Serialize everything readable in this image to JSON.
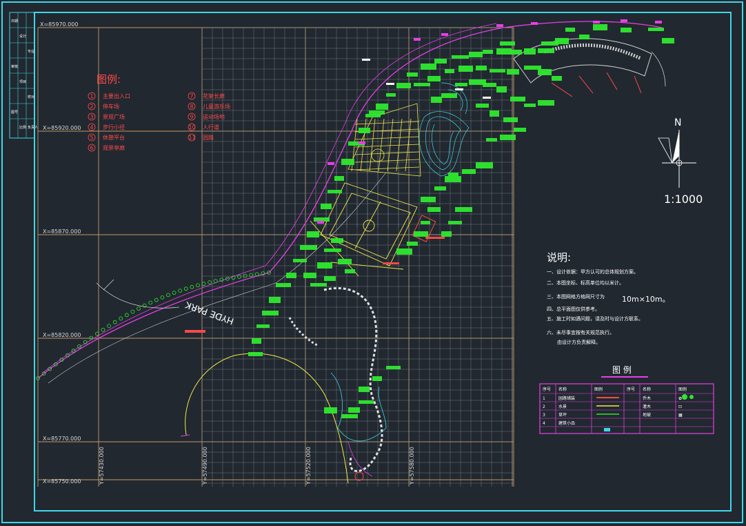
{
  "title_block": {
    "cells": [
      "日期",
      "设计",
      "专业",
      "审核",
      "项目",
      "校对",
      "图号",
      "比例",
      "负责人"
    ]
  },
  "grid": {
    "x_coords": [
      "X=85970.000",
      "X=85920.000",
      "X=85870.000",
      "X=85820.000",
      "X=85770.000",
      "X=85750.000"
    ],
    "y_coords": [
      "Y=57430.000",
      "Y=57490.000",
      "Y=57520.000",
      "Y=57580.000"
    ]
  },
  "legend": {
    "title": "图例:",
    "items": [
      {
        "num": "1",
        "label": "主要出入口"
      },
      {
        "num": "2",
        "label": "停车场"
      },
      {
        "num": "3",
        "label": "景观广场"
      },
      {
        "num": "4",
        "label": "步行小径"
      },
      {
        "num": "5",
        "label": "休憩平台"
      },
      {
        "num": "6",
        "label": "观景亭廊"
      },
      {
        "num": "7",
        "label": "花架长廊"
      },
      {
        "num": "8",
        "label": "儿童游乐场"
      },
      {
        "num": "9",
        "label": "运动场地"
      },
      {
        "num": "10",
        "label": "人行道"
      },
      {
        "num": "11",
        "label": "园路"
      }
    ]
  },
  "map": {
    "park_label": "HYDE PARK",
    "north_label": "N",
    "scale_label": "1:1000"
  },
  "notes": {
    "title": "说明:",
    "lines": [
      "一、设计依据：甲方认可的总体规划方案。",
      "二、本图坐标、标高单位均以米计。",
      "三、本图网格方格网尺寸为",
      "四、总平面图仅供参考。",
      "五、施工时如遇问题，请及时与设计方联系。",
      "六、未尽事宜按有关规范执行。"
    ],
    "grid_size": "10m×10m。",
    "extra": "由设计方负责解释。"
  },
  "symbol_table": {
    "title": "图    例",
    "headers": [
      "序号",
      "名称",
      "图例",
      "序号",
      "名称",
      "图例"
    ],
    "rows": [
      [
        "1",
        "园路铺装",
        "",
        "",
        "乔木",
        "✿"
      ],
      [
        "2",
        "水景",
        "",
        "",
        "灌木",
        "⊡"
      ],
      [
        "3",
        "草坪",
        "",
        "",
        "地被",
        "▦"
      ],
      [
        "4",
        "建筑小品",
        "",
        "",
        "",
        ""
      ],
      [
        "",
        "",
        "",
        "",
        "",
        ""
      ]
    ]
  },
  "colors": {
    "frame": "#3fd8e8",
    "grid": "#c69a66",
    "grid_light": "#8a8f96",
    "vegetation": "#2ee82e",
    "paths": "#e83ee8",
    "water": "#3fd8e8",
    "plaza": "#f2e84a",
    "label_red": "#ff4a4a",
    "white": "#ffffff"
  }
}
